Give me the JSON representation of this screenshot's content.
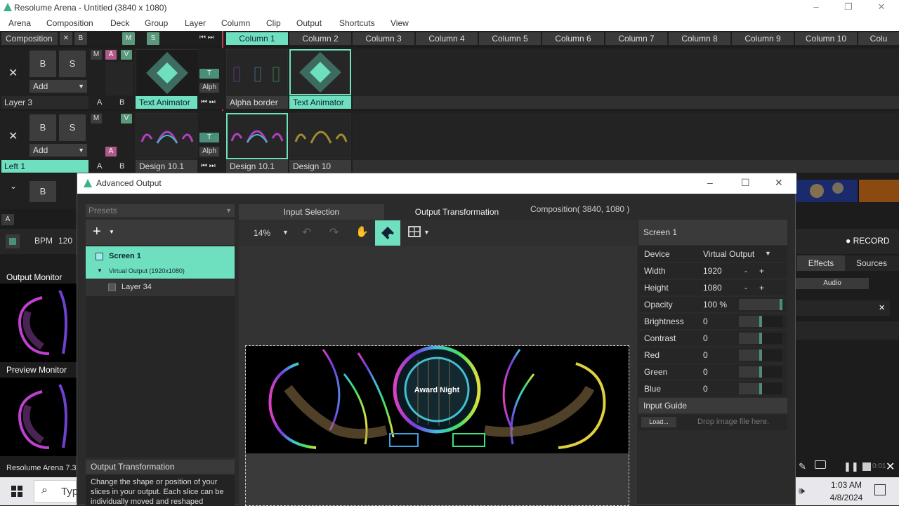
{
  "app": {
    "title": "Resolume Arena - Untitled (3840 x 1080)"
  },
  "menu": [
    "Arena",
    "Composition",
    "Deck",
    "Group",
    "Layer",
    "Column",
    "Clip",
    "Output",
    "Shortcuts",
    "View"
  ],
  "composition_header": {
    "label": "Composition",
    "x": "✕",
    "b": "B",
    "m": "M",
    "s": "S"
  },
  "columns": [
    "Column 1",
    "Column 2",
    "Column 3",
    "Column 4",
    "Column 5",
    "Column 6",
    "Column 7",
    "Column 8",
    "Column 9",
    "Column 10",
    "Colu"
  ],
  "layers": [
    {
      "name": "Layer 3",
      "add": "Add",
      "b": "B",
      "s": "S",
      "m": "M",
      "a": "A",
      "v": "V",
      "t": "T",
      "alph": "Alph",
      "ab_a": "A",
      "ab_b": "B",
      "clips": [
        "Text Animator",
        "Alpha border",
        "Text Animator"
      ]
    },
    {
      "name": "Left 1",
      "add": "Add",
      "b": "B",
      "s": "S",
      "m": "M",
      "a": "A",
      "v": "V",
      "t": "T",
      "alph": "Alph",
      "ab_a": "A",
      "ab_b": "B",
      "clips": [
        "Design 10.1",
        "Design 10.1",
        "Design 10"
      ]
    }
  ],
  "layer3_b": "B",
  "left_panel": {
    "a": "A",
    "bpm_label": "BPM",
    "bpm": "120",
    "output_monitor": "Output Monitor",
    "preview_monitor": "Preview Monitor",
    "version": "Resolume Arena 7.3."
  },
  "right_panel": {
    "record": "RECORD",
    "effects": "Effects",
    "sources": "Sources",
    "audio": "Audio",
    "close": "✕"
  },
  "dialog": {
    "title": "Advanced Output",
    "presets": "Presets",
    "tabs": {
      "input": "Input Selection",
      "output": "Output Transformation",
      "comp": "Composition( 3840, 1080 )"
    },
    "zoom": "14%",
    "screens": [
      {
        "name": "Screen 1",
        "sub": "Virtual Output (1920x1080)"
      }
    ],
    "layer_item": "Layer 34",
    "help_title": "Output Transformation",
    "help_text": "Change the shape or position of your slices in your output. Each slice can be individually moved and reshaped",
    "canvas_text": "Award Night",
    "props": {
      "header": "Screen 1",
      "device_label": "Device",
      "device": "Virtual Output",
      "width_label": "Width",
      "width": "1920",
      "height_label": "Height",
      "height": "1080",
      "opacity_label": "Opacity",
      "opacity": "100 %",
      "opacity_value": 1.0,
      "brightness_label": "Brightness",
      "brightness": "0",
      "contrast_label": "Contrast",
      "contrast": "0",
      "red_label": "Red",
      "red": "0",
      "green_label": "Green",
      "green": "0",
      "blue_label": "Blue",
      "blue": "0",
      "minus": "-",
      "plus": "+",
      "input_guide": "Input Guide",
      "load": "Load...",
      "drop": "Drop image file here."
    }
  },
  "taskbar": {
    "search": "Typ",
    "time": "1:03 AM",
    "date": "4/8/2024",
    "rec_timer": "0:01"
  },
  "colors": {
    "accent": "#6fe0bf",
    "teal": "#4b8f7a",
    "pink": "#b05a8a",
    "bg": "#1c1c1c"
  }
}
